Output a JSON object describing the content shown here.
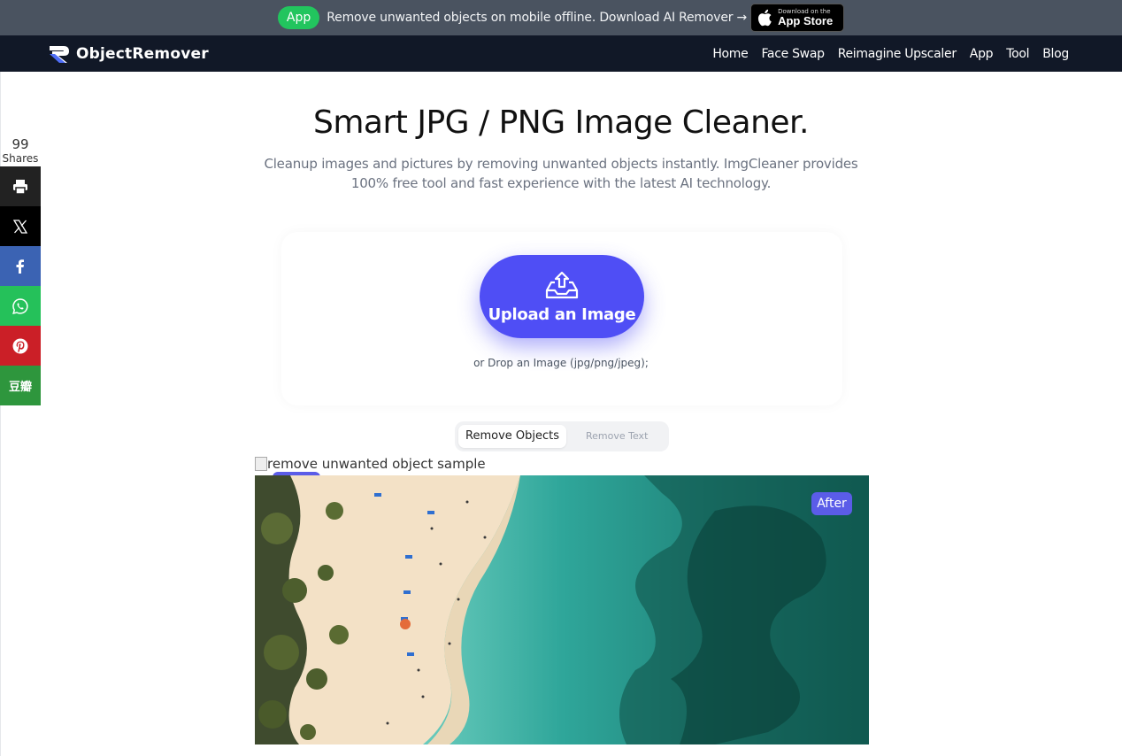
{
  "promo": {
    "badge": "App",
    "text": "Remove unwanted objects on mobile offline. Download AI Remover →",
    "store_small": "Download on the",
    "store_big": "App Store"
  },
  "nav": {
    "brand": "ObjectRemover",
    "links": [
      "Home",
      "Face Swap",
      "Reimagine Upscaler",
      "App",
      "Tool",
      "Blog"
    ]
  },
  "share": {
    "count": "99",
    "count_label": "Shares",
    "douban_label": "豆瓣",
    "buttons": [
      "print-icon",
      "x-icon",
      "facebook-icon",
      "whatsapp-icon",
      "pinterest-icon",
      "douban-icon"
    ]
  },
  "hero": {
    "title": "Smart JPG / PNG Image Cleaner.",
    "subtitle": "Cleanup images and pictures by removing unwanted objects instantly. ImgCleaner provides 100% free tool and fast experience with the latest AI technology."
  },
  "upload": {
    "button_label": "Upload an Image",
    "drop_hint": "or Drop an Image (jpg/png/jpeg);"
  },
  "tabs": {
    "items": [
      "Remove Objects",
      "Remove Text"
    ],
    "active": "Remove Objects"
  },
  "sample": {
    "alt": "remove unwanted object sample",
    "after_label": "After"
  },
  "colors": {
    "accent": "#4f4ef5",
    "nav_bg": "#111827",
    "promo_bg": "#4a5360",
    "badge_green": "#22c55e"
  }
}
